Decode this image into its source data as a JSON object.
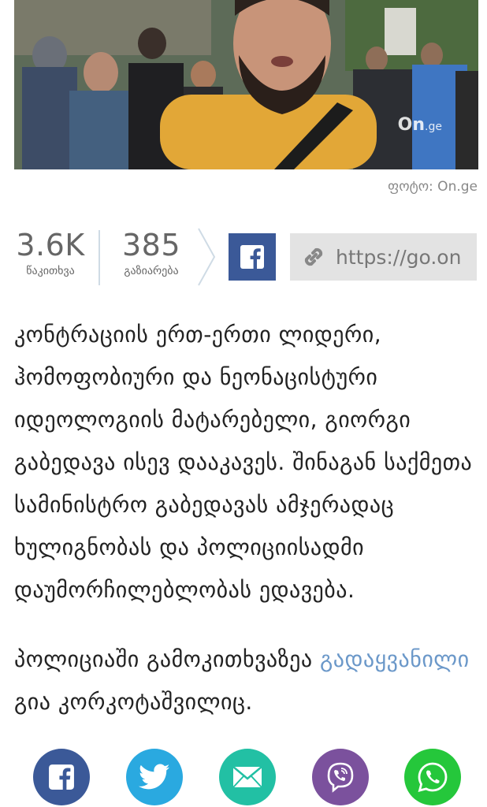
{
  "photo": {
    "watermark": "On",
    "watermark_suffix": ".ge",
    "credit": "ფოტო: On.ge"
  },
  "stats": {
    "views_count": "3.6K",
    "views_label": "წაკითხვა",
    "shares_count": "385",
    "shares_label": "გაზიარება",
    "link_text": "https://go.on"
  },
  "article": {
    "paragraph1": "კონტრაციის ერთ-ერთი ლიდერი, ჰომოფობიური და ნეონაცისტური იდეოლოგიის მატარებელი, გიორგი გაბედავა ისევ დააკავეს. შინაგან საქმეთა სამინისტრო გაბედავას ამჯერადაც ხულიგნობას და პოლიციისადმი დაუმორჩილებლობას ედავება.",
    "paragraph2_start": "პოლიციაში გამოკითხვაზეა",
    "paragraph2_link": "გადაყვანილი",
    "paragraph2_end": "გია კორკოტაშვილიც."
  },
  "colors": {
    "facebook": "#3b5998",
    "twitter": "#2aa9e0",
    "email": "#22c0a4",
    "viber": "#7b519d",
    "whatsapp": "#25c73b",
    "link": "#6b98c9"
  },
  "share_bar": [
    "facebook-icon",
    "twitter-icon",
    "mail-icon",
    "viber-icon",
    "whatsapp-icon"
  ]
}
